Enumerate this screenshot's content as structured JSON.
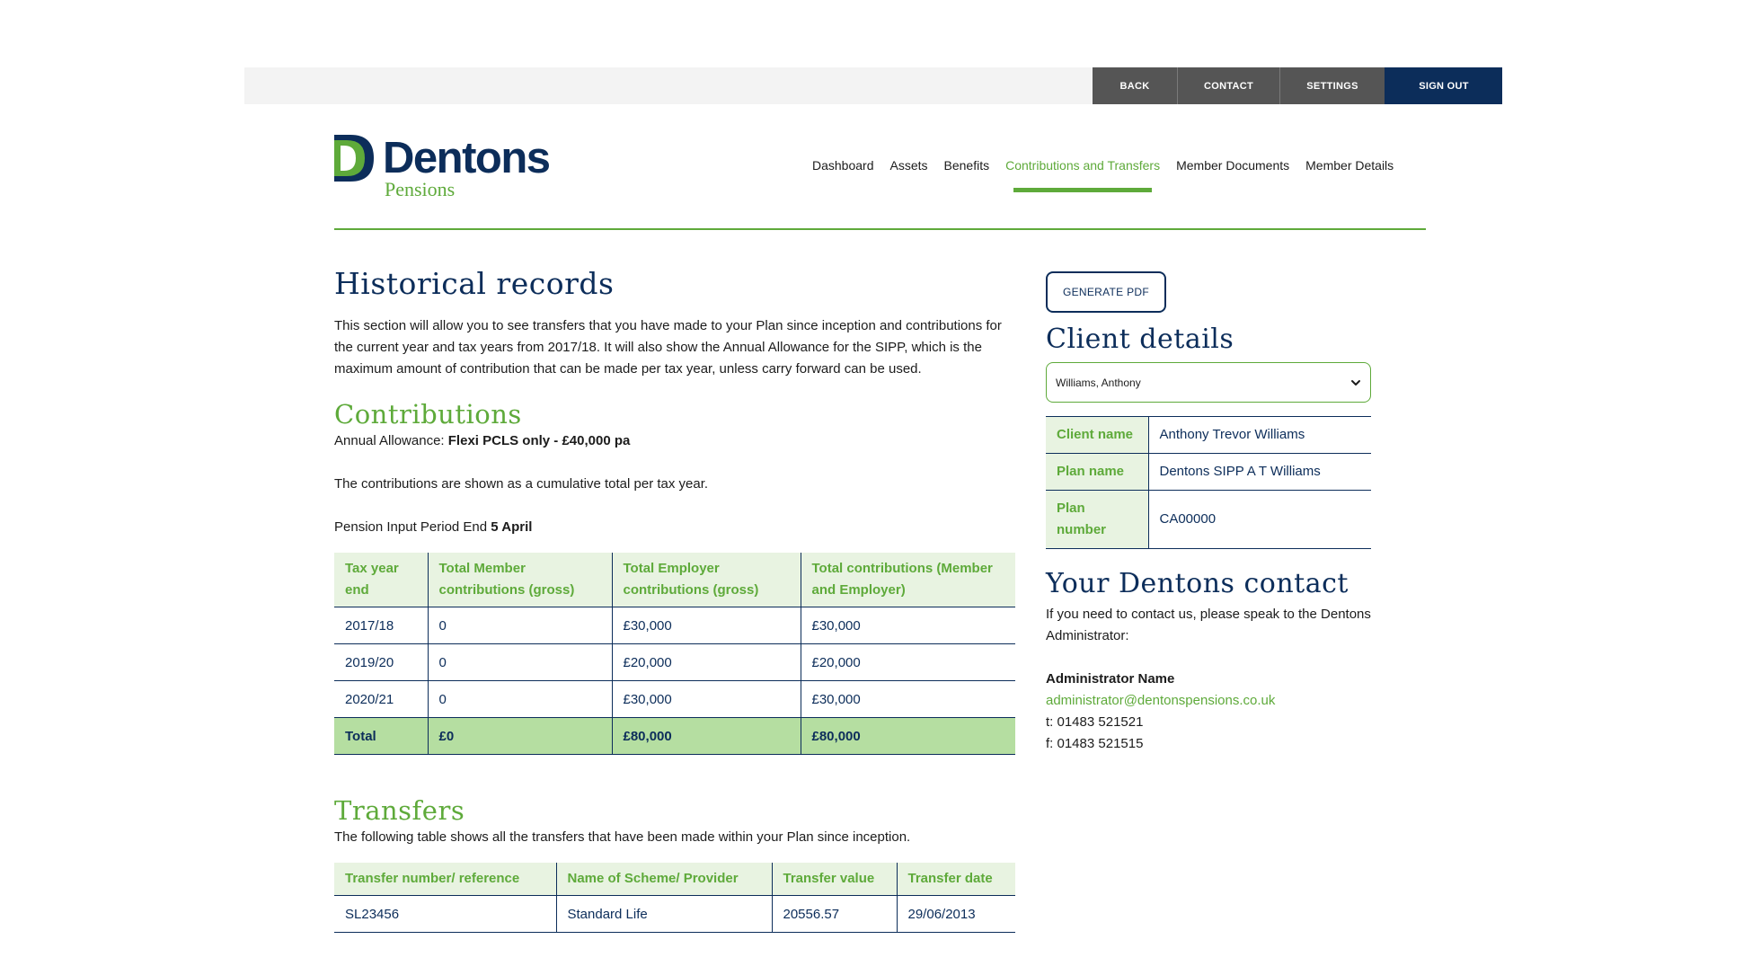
{
  "topnav": {
    "back": "BACK",
    "contact": "CONTACT",
    "settings": "SETTINGS",
    "signout": "SIGN OUT"
  },
  "logo": {
    "name": "Dentons",
    "sub": "Pensions"
  },
  "mainnav": [
    {
      "label": "Dashboard",
      "active": false
    },
    {
      "label": "Assets",
      "active": false
    },
    {
      "label": "Benefits",
      "active": false
    },
    {
      "label": "Contributions and Transfers",
      "active": true
    },
    {
      "label": "Member Documents",
      "active": false
    },
    {
      "label": "Member Details",
      "active": false
    }
  ],
  "page": {
    "title": "Historical records",
    "intro": "This section will allow you to see transfers that you have made to your Plan since inception and contributions for the current year and tax years from 2017/18. It will also show the Annual Allowance for the SIPP, which is the maximum amount of contribution that can be made per tax year, unless carry forward can be used."
  },
  "contributions": {
    "title": "Contributions",
    "allowance_label": "Annual Allowance: ",
    "allowance_value": "Flexi PCLS only - £40,000 pa",
    "cumulative_note": "The contributions are shown as a cumulative total per tax year.",
    "pip_label": "Pension Input Period End ",
    "pip_value": "5 April",
    "headers": [
      "Tax year end",
      "Total Member contributions (gross)",
      "Total Employer contributions (gross)",
      "Total contributions (Member and Employer)"
    ],
    "rows": [
      [
        "2017/18",
        "0",
        "£30,000",
        "£30,000"
      ],
      [
        "2019/20",
        "0",
        "£20,000",
        "£20,000"
      ],
      [
        "2020/21",
        "0",
        "£30,000",
        "£30,000"
      ]
    ],
    "total": [
      "Total",
      "£0",
      "£80,000",
      "£80,000"
    ]
  },
  "transfers": {
    "title": "Transfers",
    "description": "The following table shows all the transfers that have been made within your Plan since inception.",
    "headers": [
      "Transfer number/ reference",
      "Name of Scheme/ Provider",
      "Transfer value",
      "Transfer date"
    ],
    "rows": [
      [
        "SL23456",
        "Standard Life",
        "20556.57",
        "29/06/2013"
      ]
    ]
  },
  "sidebar": {
    "pdf_button": "GENERATE PDF",
    "client_title": "Client details",
    "client_select": "Williams, Anthony",
    "details": [
      {
        "label": "Client name",
        "value": "Anthony Trevor Williams"
      },
      {
        "label": "Plan name",
        "value": "Dentons SIPP A T Williams"
      },
      {
        "label": "Plan number",
        "value": "CA00000"
      }
    ],
    "contact_title": "Your Dentons contact",
    "contact_text": "If you need to contact us, please speak to the Dentons Administrator:",
    "admin_name": "Administrator Name",
    "admin_email": "administrator@dentonspensions.co.uk",
    "phone": "t: 01483 521521",
    "fax": "f: 01483 521515"
  },
  "colors": {
    "navy": "#0c2d5a",
    "green": "#5eaa3a",
    "light_green": "#e8f3e1",
    "total_green": "#b5dea1",
    "dark_gray": "#555555"
  }
}
